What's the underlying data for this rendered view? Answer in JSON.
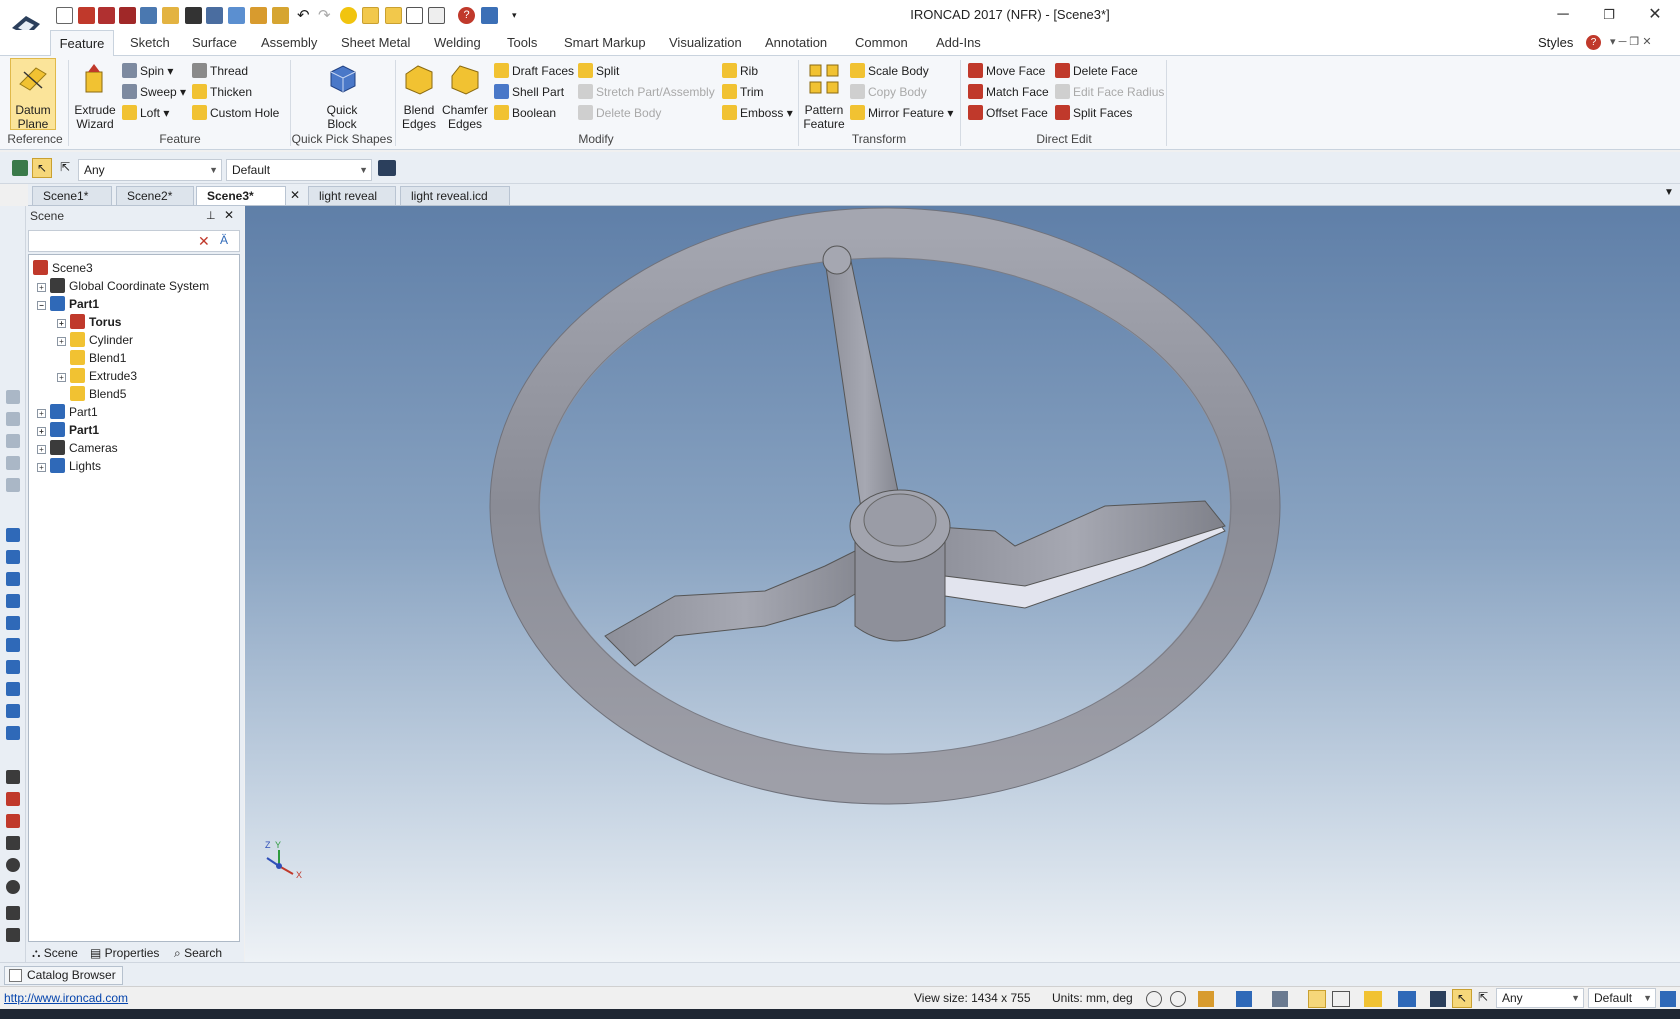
{
  "window": {
    "title": "IRONCAD 2017 (NFR) - [Scene3*]",
    "controls": {
      "minimize": "─",
      "restore": "❐",
      "close": "✕"
    }
  },
  "ribbon_tabs": [
    "Feature",
    "Sketch",
    "Surface",
    "Assembly",
    "Sheet Metal",
    "Welding",
    "Tools",
    "Smart Markup",
    "Visualization",
    "Annotation",
    "Common",
    "Add-Ins"
  ],
  "styles_label": "Styles",
  "ribbon": {
    "reference": {
      "label": "Reference",
      "datum_plane": "Datum Plane"
    },
    "feature": {
      "label": "Feature",
      "extrude_wizard": "Extrude Wizard",
      "spin": "Spin",
      "sweep": "Sweep",
      "loft": "Loft",
      "thread": "Thread",
      "thicken": "Thicken",
      "custom_hole": "Custom Hole"
    },
    "quick_pick": {
      "label": "Quick Pick Shapes",
      "quick_block": "Quick Block"
    },
    "modify": {
      "label": "Modify",
      "blend_edges": "Blend Edges",
      "chamfer_edges": "Chamfer Edges",
      "draft_faces": "Draft Faces",
      "shell_part": "Shell Part",
      "boolean": "Boolean",
      "split": "Split",
      "stretch": "Stretch Part/Assembly",
      "delete_body": "Delete Body",
      "rib": "Rib",
      "trim": "Trim",
      "emboss": "Emboss"
    },
    "transform": {
      "label": "Transform",
      "pattern_feature": "Pattern Feature",
      "scale_body": "Scale Body",
      "copy_body": "Copy Body",
      "mirror_feature": "Mirror Feature"
    },
    "direct_edit": {
      "label": "Direct Edit",
      "move_face": "Move Face",
      "match_face": "Match Face",
      "offset_face": "Offset Face",
      "delete_face": "Delete Face",
      "edit_face_radius": "Edit Face Radius",
      "split_faces": "Split Faces"
    }
  },
  "selection_bar": {
    "filter": "Any",
    "style": "Default"
  },
  "doc_tabs": [
    "Scene1*",
    "Scene2*",
    "Scene3*",
    "light reveal",
    "light reveal.icd"
  ],
  "scene_panel": {
    "title": "Scene",
    "tree": [
      {
        "label": "Scene3",
        "bold": false
      },
      {
        "label": "Global Coordinate System",
        "bold": false
      },
      {
        "label": "Part1",
        "bold": true
      },
      {
        "label": "Torus",
        "bold": true
      },
      {
        "label": "Cylinder",
        "bold": false
      },
      {
        "label": "Blend1",
        "bold": false
      },
      {
        "label": "Extrude3",
        "bold": false
      },
      {
        "label": "Blend5",
        "bold": false
      },
      {
        "label": "Part1",
        "bold": false
      },
      {
        "label": "Part1",
        "bold": true
      },
      {
        "label": "Cameras",
        "bold": false
      },
      {
        "label": "Lights",
        "bold": false
      }
    ],
    "tabs": [
      "Scene",
      "Properties",
      "Search"
    ]
  },
  "viewport": {
    "triad": {
      "x": "X",
      "y": "Y",
      "z": "Z"
    }
  },
  "catalog_browser": "Catalog Browser",
  "status": {
    "link": "http://www.ironcad.com",
    "view_size": "View size: 1434 x  755",
    "units": "Units: mm, deg",
    "filter": "Any",
    "style": "Default"
  },
  "colors": {
    "accent": "#2b5797",
    "viewport_top": "#5f7fa8",
    "part": "#9a9aa4"
  }
}
